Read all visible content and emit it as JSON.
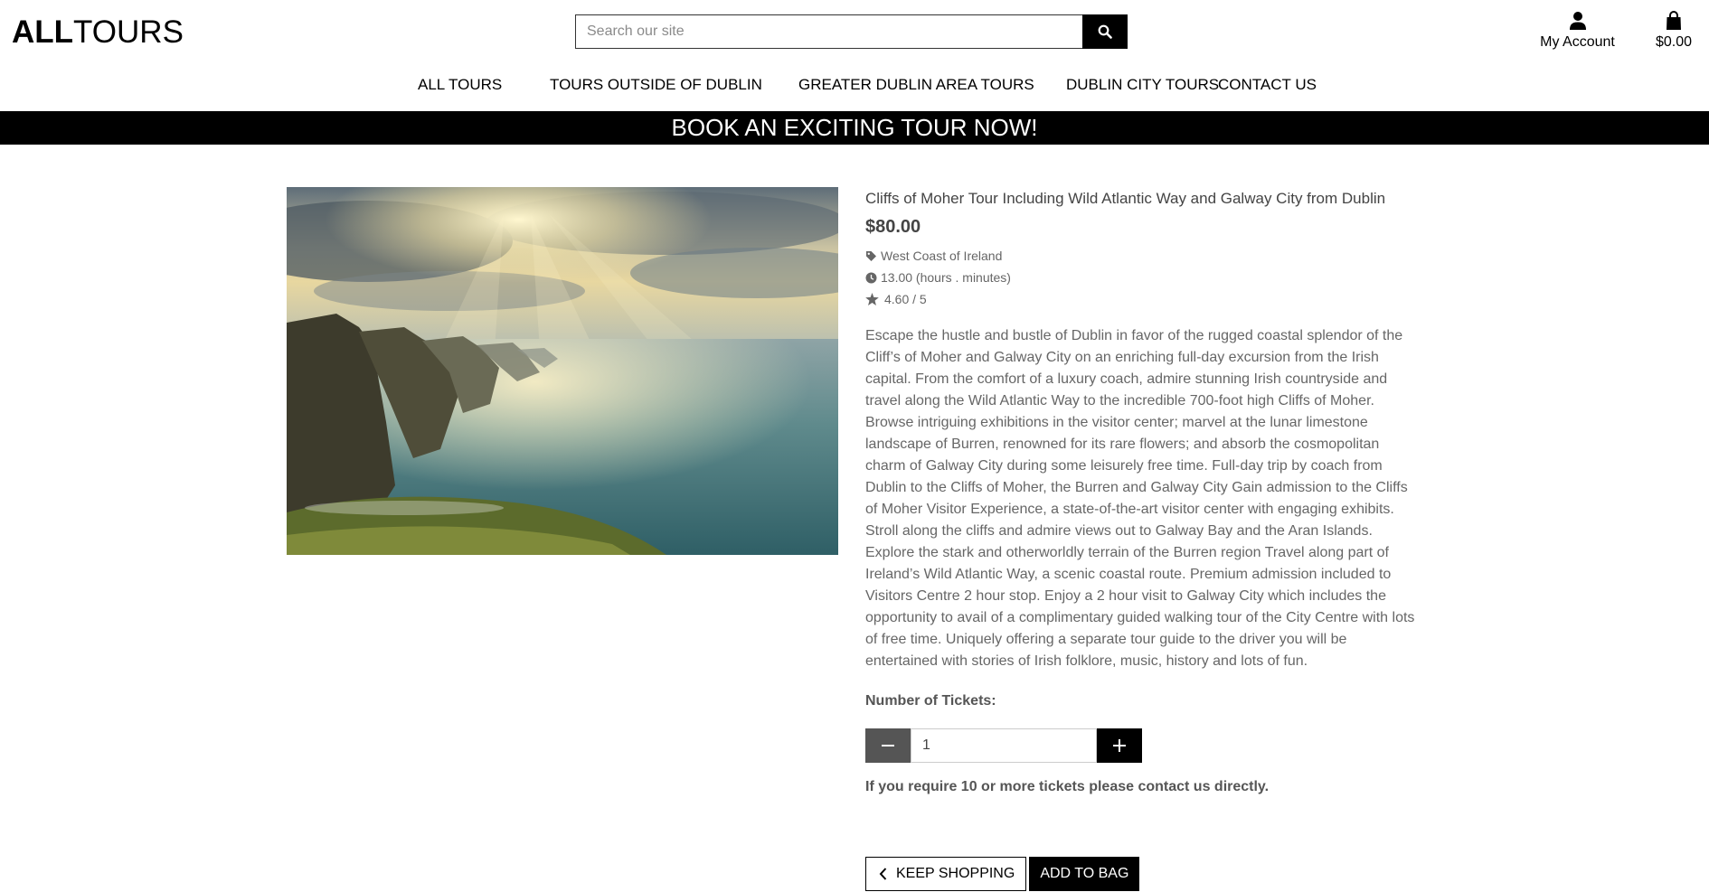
{
  "header": {
    "logo_bold": "ALL",
    "logo_light": "TOURS",
    "search_placeholder": "Search our site",
    "account_label": "My Account",
    "bag_total": "$0.00"
  },
  "nav": {
    "items": [
      {
        "label": "ALL TOURS"
      },
      {
        "label": "TOURS OUTSIDE OF DUBLIN"
      },
      {
        "label": "GREATER DUBLIN AREA TOURS"
      },
      {
        "label": "DUBLIN CITY TOURS"
      },
      {
        "label": "CONTACT US"
      }
    ]
  },
  "banner": "BOOK AN EXCITING TOUR NOW!",
  "product": {
    "title": "Cliffs of Moher Tour Including Wild Atlantic Way and Galway City from Dublin",
    "price": "$80.00",
    "category": "West Coast of Ireland",
    "duration": "13.00 (hours . minutes)",
    "rating": "4.60 / 5",
    "description": "Escape the hustle and bustle of Dublin in favor of the rugged coastal splendor of the Cliff’s of Moher and Galway City on an enriching full-day excursion from the Irish capital. From the comfort of a luxury coach, admire stunning Irish countryside and travel along the Wild Atlantic Way to the incredible 700-foot high Cliffs of Moher. Browse intriguing exhibitions in the visitor center; marvel at the lunar limestone landscape of Burren, renowned for its rare flowers; and absorb the cosmopolitan charm of Galway City during some leisurely free time. Full-day trip by coach from Dublin to the Cliffs of Moher, the Burren and Galway City Gain admission to the Cliffs of Moher Visitor Experience, a state-of-the-art visitor center with engaging exhibits. Stroll along the cliffs and admire views out to Galway Bay and the Aran Islands. Explore the stark and otherworldly terrain of the Burren region Travel along part of Ireland’s Wild Atlantic Way, a scenic coastal route. Premium admission included to Visitors Centre 2 hour stop. Enjoy a 2 hour visit to Galway City which includes the opportunity to avail of a complimentary guided walking tour of the City Centre with lots of free time. Uniquely offering a separate tour guide to the driver you will be entertained with stories of Irish folklore, music, history and lots of fun."
  },
  "tickets": {
    "label": "Number of Tickets:",
    "quantity": "1",
    "note": "If you require 10 or more tickets please contact us directly."
  },
  "actions": {
    "keep_shopping": "KEEP SHOPPING",
    "add_to_bag": "ADD TO BAG"
  },
  "colors": {
    "primary": "#000000",
    "text": "#555555",
    "minus_button": "#555555"
  }
}
